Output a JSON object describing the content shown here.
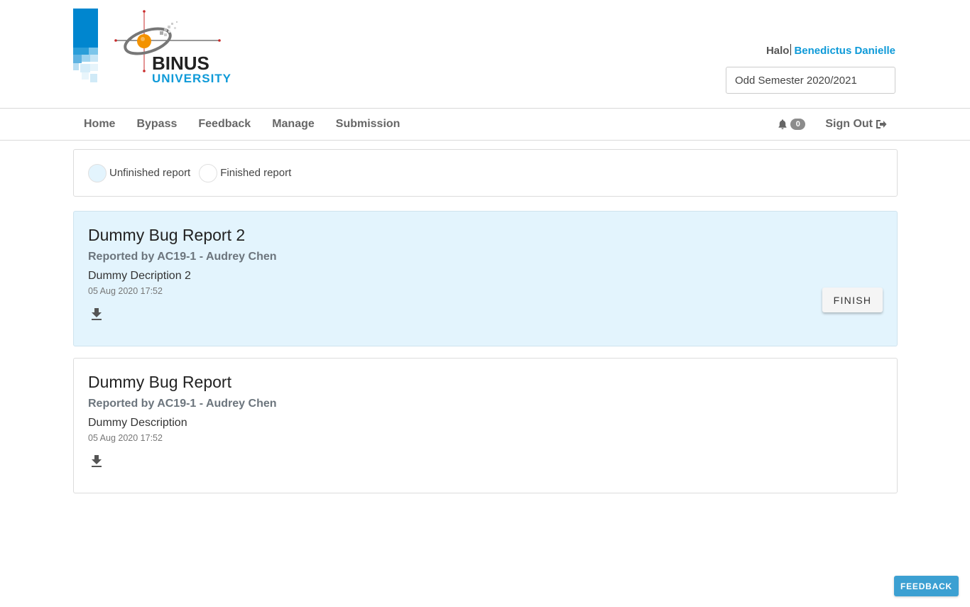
{
  "logo": {
    "line1": "BINUS",
    "line2": "UNIVERSITY"
  },
  "user": {
    "greeting": "Halo",
    "name": "Benedictus Danielle"
  },
  "semester": {
    "value": "Odd Semester 2020/2021"
  },
  "nav": {
    "items": [
      {
        "label": "Home"
      },
      {
        "label": "Bypass"
      },
      {
        "label": "Feedback"
      },
      {
        "label": "Manage"
      },
      {
        "label": "Submission"
      }
    ],
    "notification_count": "0",
    "signout_label": "Sign Out"
  },
  "legend": {
    "unfinished_label": "Unfinished report",
    "finished_label": "Finished report"
  },
  "reports": [
    {
      "title": "Dummy Bug Report 2",
      "reporter": "Reported by AC19-1 - Audrey Chen",
      "description": "Dummy Decription 2",
      "date": "05 Aug 2020 17:52",
      "status": "unfinished",
      "finish_label": "FINISH"
    },
    {
      "title": "Dummy Bug Report",
      "reporter": "Reported by AC19-1 - Audrey Chen",
      "description": "Dummy Description",
      "date": "05 Aug 2020 17:52",
      "status": "finished"
    }
  ],
  "feedback_button": "FEEDBACK",
  "colors": {
    "brand_blue": "#0e9ad8",
    "unfinished_bg": "#e3f4fd",
    "brand_orange": "#f39200"
  },
  "icons": [
    "bell-icon",
    "sign-out-icon",
    "download-icon"
  ]
}
